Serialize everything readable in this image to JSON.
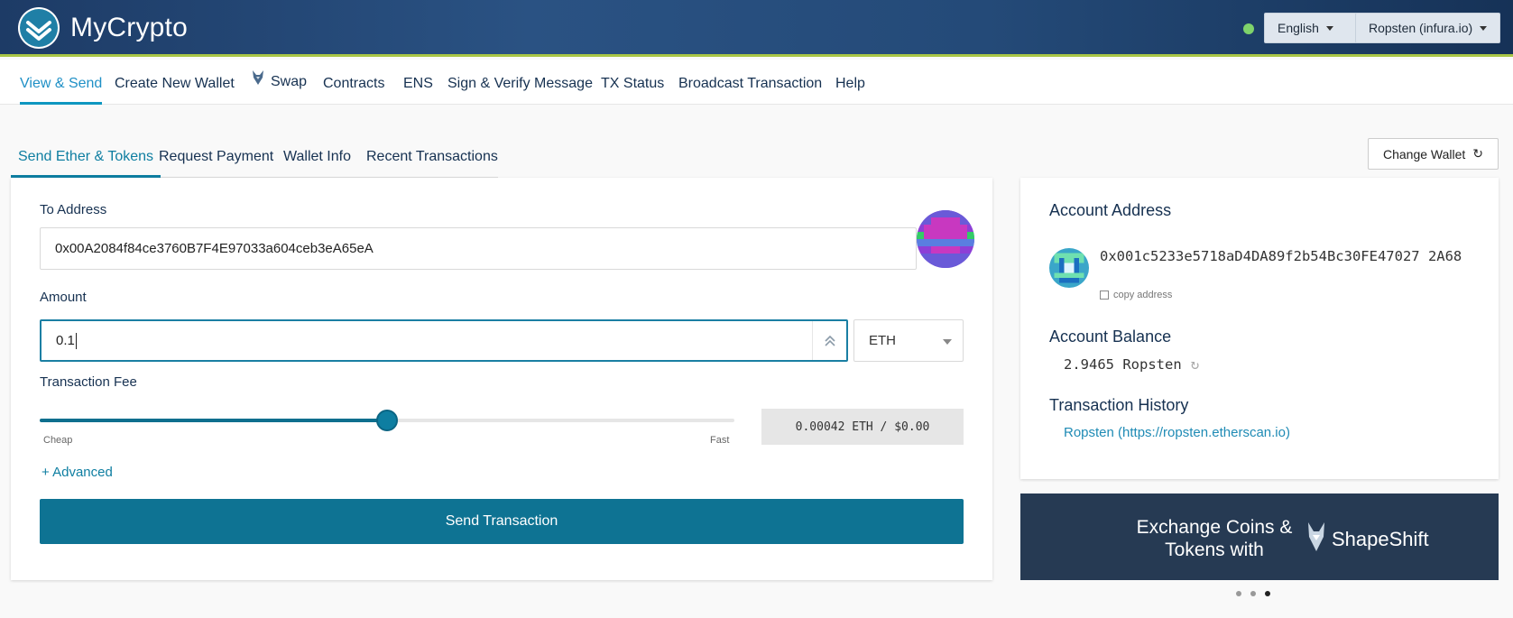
{
  "header": {
    "brand": "MyCrypto",
    "language": "English",
    "network": "Ropsten (infura.io)",
    "status_color": "#7fd36b"
  },
  "mainnav": {
    "items": [
      {
        "label": "View & Send",
        "active": true
      },
      {
        "label": "Create New Wallet"
      },
      {
        "label": "Swap",
        "icon": "shapeshift-fox-icon"
      },
      {
        "label": "Contracts"
      },
      {
        "label": "ENS"
      },
      {
        "label": "Sign & Verify Message"
      },
      {
        "label": "TX Status"
      },
      {
        "label": "Broadcast Transaction"
      },
      {
        "label": "Help"
      }
    ]
  },
  "subtabs": {
    "items": [
      {
        "label": "Send Ether & Tokens",
        "active": true
      },
      {
        "label": "Request Payment"
      },
      {
        "label": "Wallet Info"
      },
      {
        "label": "Recent Transactions"
      }
    ],
    "change_wallet": "Change Wallet"
  },
  "send": {
    "to_label": "To Address",
    "to_value": "0x00A2084f84ce3760B7F4E97033a604ceb3eA65eA",
    "amount_label": "Amount",
    "amount_value": "0.1",
    "unit": "ETH",
    "fee_label": "Transaction Fee",
    "fee_level": 0.5,
    "slider_min_label": "Cheap",
    "slider_max_label": "Fast",
    "fee_value": "0.00042 ETH / $0.00",
    "advanced_label": "+ Advanced",
    "send_button": "Send Transaction"
  },
  "account": {
    "address_label": "Account Address",
    "address": "0x001c5233e5718aD4DA89f2b54Bc30FE47027 2A68",
    "copy_label": "copy address",
    "balance_label": "Account Balance",
    "balance": "2.9465 Ropsten",
    "history_label": "Transaction History",
    "history_link": "Ropsten (https://ropsten.etherscan.io)"
  },
  "banner": {
    "text": "Exchange Coins & Tokens with",
    "brand": "ShapeShift",
    "active_dot": 2
  },
  "colors": {
    "accent": "#0e7393",
    "header": "#1d3b66",
    "header_border": "#a8c545"
  }
}
